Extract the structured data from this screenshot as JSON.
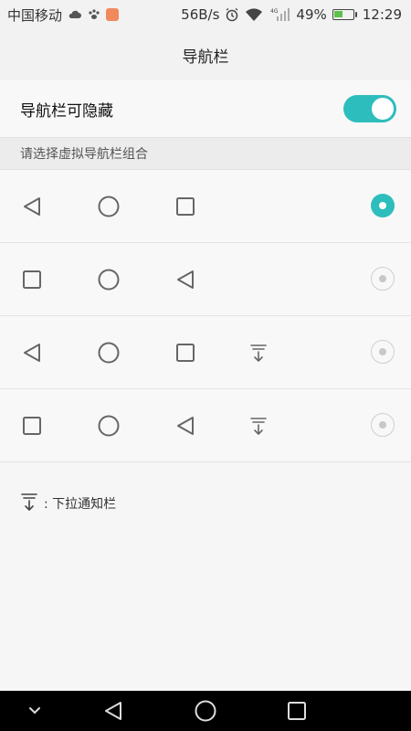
{
  "status_bar": {
    "carrier": "中国移动",
    "speed": "56B/s",
    "network": "4G",
    "battery_percent": "49%",
    "battery_level": 0.49,
    "time": "12:29"
  },
  "title": "导航栏",
  "toggle_row": {
    "label": "导航栏可隐藏",
    "enabled": true
  },
  "section_header": "请选择虚拟导航栏组合",
  "options": [
    {
      "icons": [
        "back-icon",
        "home-icon",
        "recent-icon"
      ],
      "selected": true
    },
    {
      "icons": [
        "recent-icon",
        "home-icon",
        "back-icon"
      ],
      "selected": false
    },
    {
      "icons": [
        "back-icon",
        "home-icon",
        "recent-icon",
        "pull-down-notification-icon"
      ],
      "selected": false
    },
    {
      "icons": [
        "recent-icon",
        "home-icon",
        "back-icon",
        "pull-down-notification-icon"
      ],
      "selected": false
    }
  ],
  "legend": {
    "icon": "pull-down-notification-icon",
    "text": ": 下拉通知栏"
  },
  "colors": {
    "accent": "#2ebdbd",
    "background": "#f6f6f6",
    "nav_bar": "#000000"
  },
  "system_nav": [
    "hide-chevron-icon",
    "back-icon",
    "home-icon",
    "recent-icon"
  ]
}
